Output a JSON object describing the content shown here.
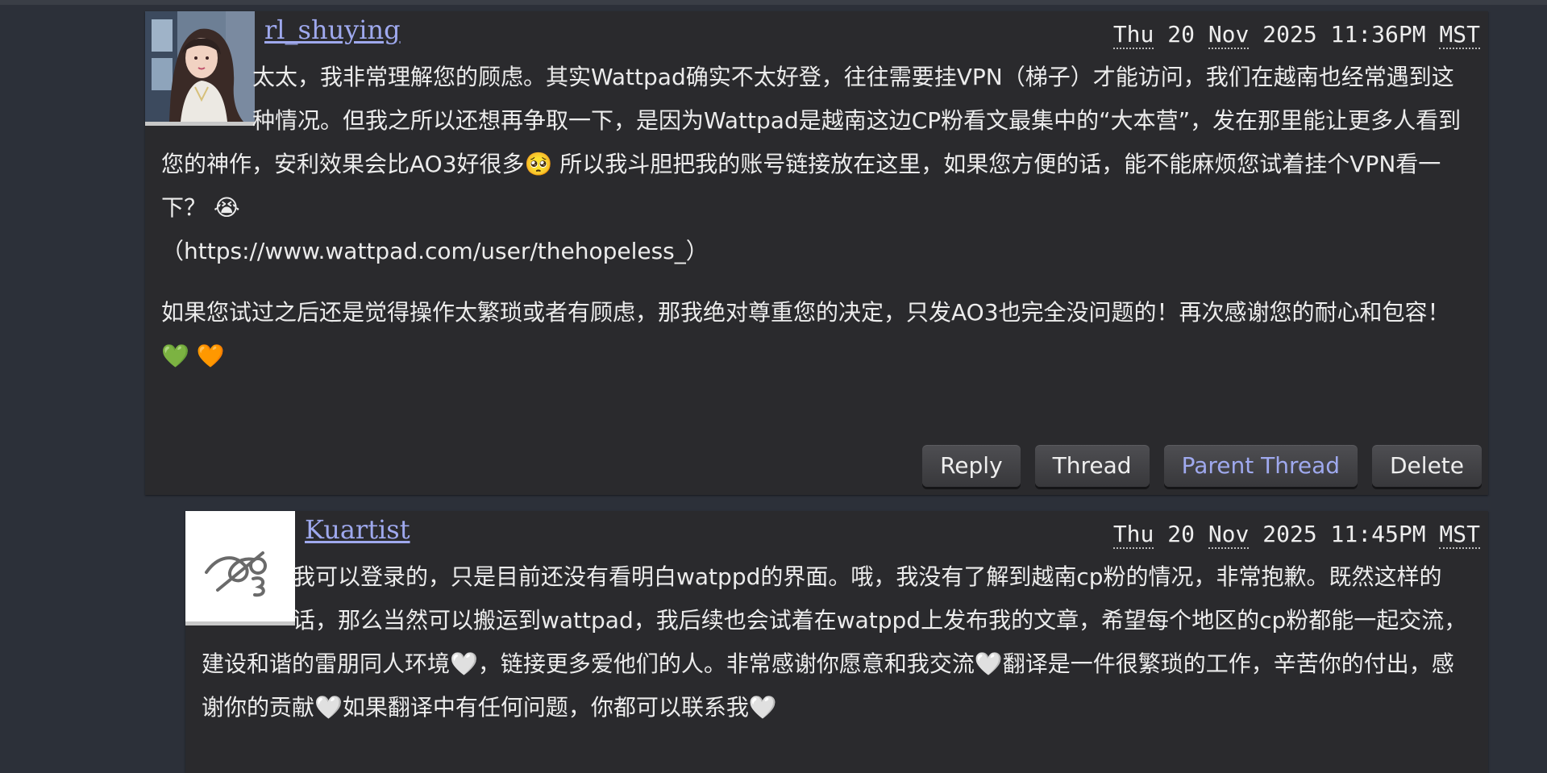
{
  "comments": [
    {
      "username": "rl_shuying",
      "timestamp": {
        "day": "Thu",
        "date": "20",
        "month": "Nov",
        "year_time": "2025 11:36PM",
        "tz": "MST"
      },
      "paragraphs": [
        "太太，我非常理解您的顾虑。其实Wattpad确实不太好登，往往需要挂VPN（梯子）才能访问，我们在越南也经常遇到这种情况。但我之所以还想再争取一下，是因为Wattpad是越南这边CP粉看文最集中的“大本营”，发在那里能让更多人看到您的神作，安利效果会比AO3好很多🥺 所以我斗胆把我的账号链接放在这里，如果您方便的话，能不能麻烦您试着挂个VPN看一下？ 😭",
        "（https://www.wattpad.com/user/thehopeless_）",
        "如果您试过之后还是觉得操作太繁琐或者有顾虑，那我绝对尊重您的决定，只发AO3也完全没问题的！再次感谢您的耐心和包容！ 💚 🧡"
      ],
      "actions": {
        "reply": "Reply",
        "thread": "Thread",
        "parent_thread": "Parent Thread",
        "delete": "Delete"
      }
    },
    {
      "username": "Kuartist",
      "timestamp": {
        "day": "Thu",
        "date": "20",
        "month": "Nov",
        "year_time": "2025 11:45PM",
        "tz": "MST"
      },
      "paragraphs": [
        "我可以登录的，只是目前还没有看明白watppd的界面。哦，我没有了解到越南cp粉的情况，非常抱歉。既然这样的话，那么当然可以搬运到wattpad，我后续也会试着在watppd上发布我的文章，希望每个地区的cp粉都能一起交流，建设和谐的雷朋同人环境🤍，链接更多爱他们的人。非常感谢你愿意和我交流🤍翻译是一件很繁琐的工作，辛苦你的付出，感谢你的贡献🤍如果翻译中有任何问题，你都可以联系我🤍"
      ]
    }
  ]
}
